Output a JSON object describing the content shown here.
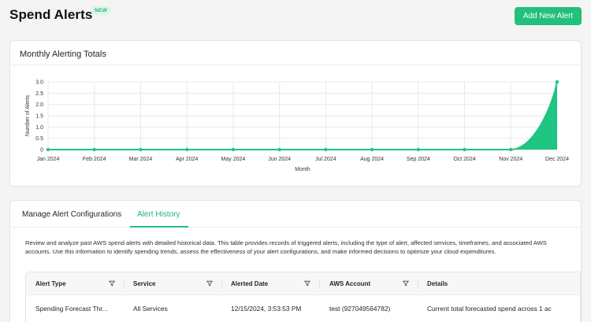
{
  "header": {
    "title": "Spend Alerts",
    "badge": "NEW",
    "add_button": "Add New Alert"
  },
  "chart_card": {
    "title": "Monthly Alerting Totals"
  },
  "chart_data": {
    "type": "area",
    "title": "",
    "xlabel": "Month",
    "ylabel": "Number of Alerts",
    "categories": [
      "Jan 2024",
      "Feb 2024",
      "Mar 2024",
      "Apr 2024",
      "May 2024",
      "Jun 2024",
      "Jul 2024",
      "Aug 2024",
      "Sep 2024",
      "Oct 2024",
      "Nov 2024",
      "Dec 2024"
    ],
    "values": [
      0,
      0,
      0,
      0,
      0,
      0,
      0,
      0,
      0,
      0,
      0,
      3
    ],
    "yticks": [
      "0",
      "0.5",
      "1.0",
      "1.5",
      "2.0",
      "2.5",
      "3.0"
    ],
    "ylim": [
      0,
      3
    ],
    "grid": true,
    "color": "#1fc580"
  },
  "tabs": {
    "manage": "Manage Alert Configurations",
    "history": "Alert History"
  },
  "description": "Review and analyze past AWS spend alerts with detailed historical data. This table provides records of triggered alerts, including the type of alert, affected services, timeframes, and associated AWS accounts. Use this information to identify spending trends, assess the effectiveness of your alert configurations, and make informed decisions to optimize your cloud expenditures.",
  "table": {
    "columns": [
      "Alert Type",
      "Service",
      "Alerted Date",
      "AWS Account",
      "Details"
    ],
    "rows": [
      [
        "Spending Forecast Thr...",
        "All Services",
        "12/15/2024, 3:53:53 PM",
        "test (927049564782)",
        "Current total forecasted spend across 1 ac"
      ]
    ]
  },
  "colors": {
    "accent": "#22c07a",
    "chart_fill": "#1fc580"
  }
}
